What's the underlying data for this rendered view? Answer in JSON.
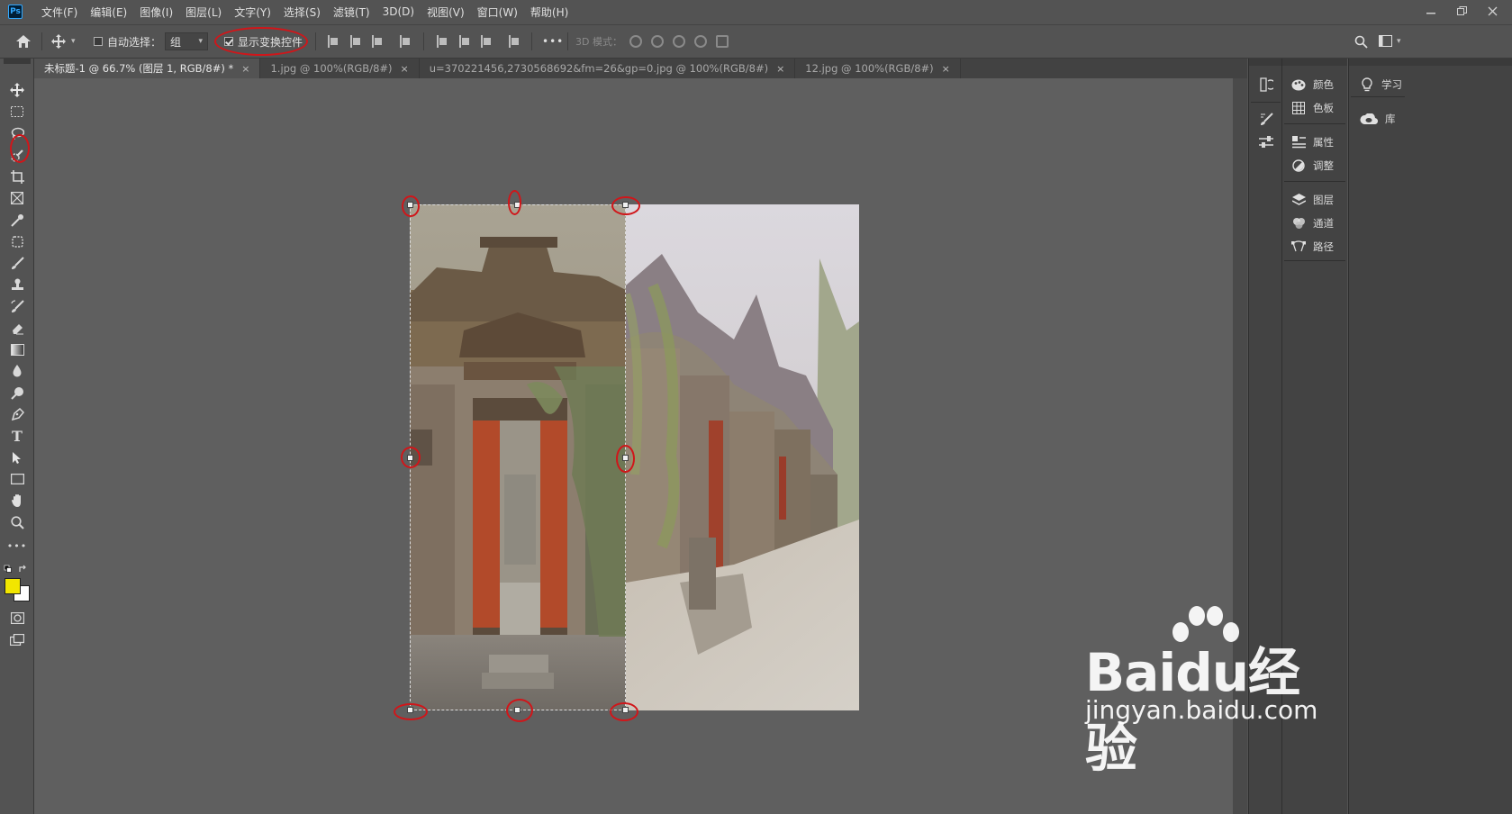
{
  "menu": [
    "文件(F)",
    "编辑(E)",
    "图像(I)",
    "图层(L)",
    "文字(Y)",
    "选择(S)",
    "滤镜(T)",
    "3D(D)",
    "视图(V)",
    "窗口(W)",
    "帮助(H)"
  ],
  "logo": "Ps",
  "options": {
    "auto_select_label": "自动选择：",
    "auto_select_value": "组",
    "show_transform_label": "显示变换控件",
    "threed_mode_label": "3D 模式：",
    "more": "•••"
  },
  "tabs": [
    {
      "label": "未标题-1 @ 66.7% (图层 1, RGB/8#) *",
      "close": "×"
    },
    {
      "label": "1.jpg @ 100%(RGB/8#)",
      "close": "×"
    },
    {
      "label": "u=370221456,2730568692&fm=26&gp=0.jpg @ 100%(RGB/8#)",
      "close": "×"
    },
    {
      "label": "12.jpg @ 100%(RGB/8#)",
      "close": "×"
    }
  ],
  "panels": {
    "group1": [
      "颜色",
      "色板"
    ],
    "group2": [
      "属性",
      "调整"
    ],
    "group3": [
      "图层",
      "通道",
      "路径"
    ],
    "group4": [
      "学习",
      "库"
    ]
  },
  "colors": {
    "foreground": "#f2e600",
    "background": "#ffffff",
    "annotation": "#d0161a"
  },
  "watermark": {
    "main": "Baidu经验",
    "sub": "jingyan.baidu.com"
  }
}
